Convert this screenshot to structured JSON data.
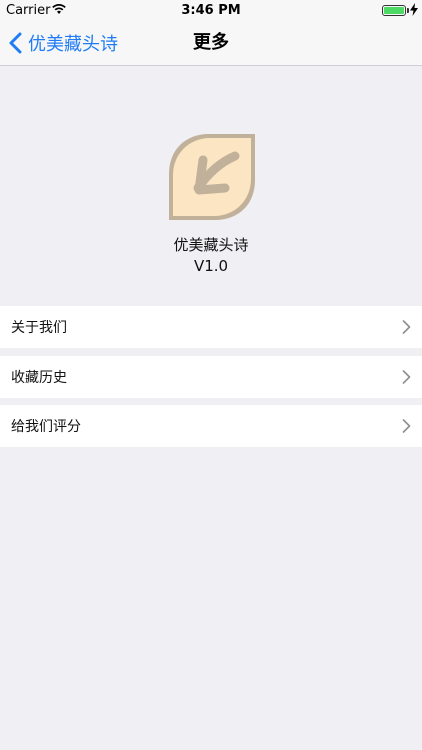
{
  "status_bar": {
    "carrier": "Carrier",
    "time": "3:46 PM",
    "battery_level": 1.0
  },
  "nav": {
    "back_label": "优美藏头诗",
    "title": "更多"
  },
  "app": {
    "name": "优美藏头诗",
    "version": "V1.0"
  },
  "menu": [
    {
      "label": "关于我们"
    },
    {
      "label": "收藏历史"
    },
    {
      "label": "给我们评分"
    }
  ],
  "colors": {
    "accent": "#1f7cf6",
    "background": "#efeff4",
    "icon_fill": "#fce5c2",
    "icon_stroke": "#c2b19a"
  }
}
